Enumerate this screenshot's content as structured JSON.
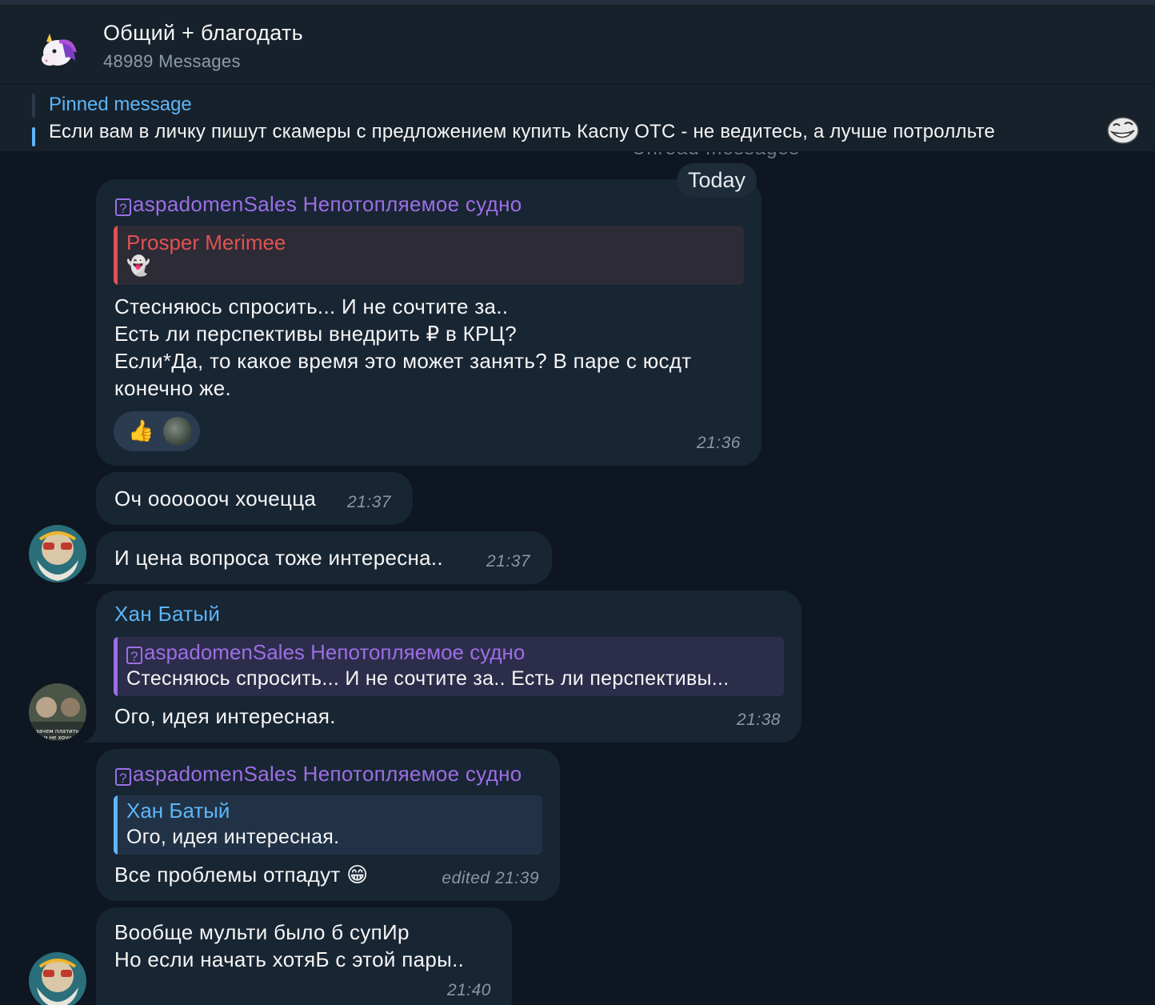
{
  "header": {
    "title": "Общий + благодать",
    "subtitle": "48989 Messages",
    "avatar_icon": "unicorn-icon"
  },
  "pinned": {
    "title": "Pinned message",
    "text": "Если вам в личку пишут скамеры с предложением купить Каспу ОТС - не ведитесь, а лучше потролльте",
    "emoji_icon": "trollface-icon"
  },
  "chat": {
    "unread_label": "Unread messages",
    "date": "Today"
  },
  "messages": [
    {
      "forwarded_from": "aspadomenSales Непотопляемое судно",
      "reply_name": "Prosper Merimee",
      "reply_text": "👻",
      "lines": [
        "Стесняюсь спросить... И не сочтите за..",
        "Есть ли перспективы внедрить ₽ в КРЦ?",
        "Если*Да, то какое время это может занять? В паре с юсдт",
        "конечно же."
      ],
      "reaction": "👍",
      "time": "21:36"
    },
    {
      "text": "Оч ооооооч хочецца",
      "time": "21:37"
    },
    {
      "text": "И цена вопроса тоже интересна..",
      "time": "21:37"
    },
    {
      "sender": "Хан Батый",
      "reply_name": "aspadomenSales Непотопляемое судно",
      "reply_text": "Стесняюсь спросить... И не сочтите за..  Есть ли перспективы...",
      "text": "Ого, идея интересная.",
      "time": "21:38"
    },
    {
      "forwarded_from": "aspadomenSales Непотопляемое судно",
      "reply_name": "Хан Батый",
      "reply_text": "Ого, идея интересная.",
      "text": "Все проблемы отпадут",
      "emoji": "😁",
      "time": "edited 21:39"
    },
    {
      "lines": [
        "Вообще мульти было б супИр",
        "Но если начать хотяБ с этой пары.."
      ],
      "time": "21:40"
    }
  ]
}
